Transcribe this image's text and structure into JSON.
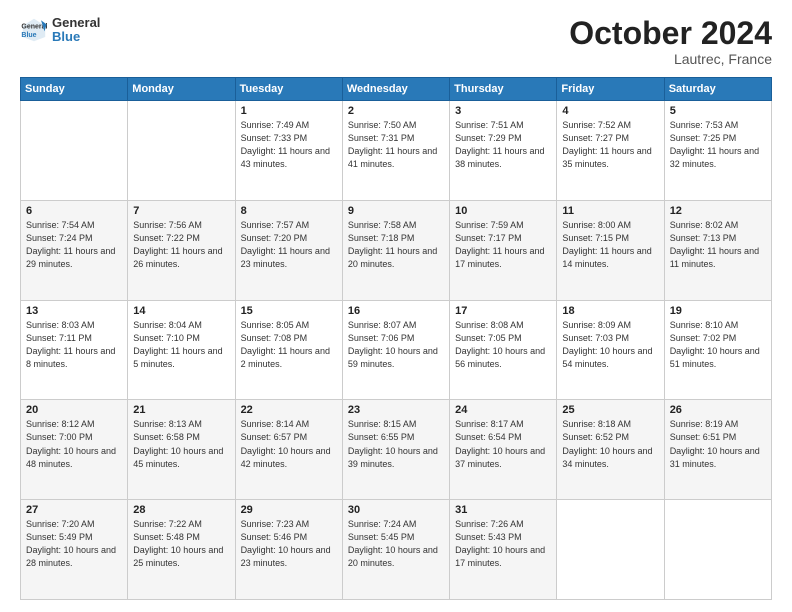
{
  "header": {
    "logo_general": "General",
    "logo_blue": "Blue",
    "month_title": "October 2024",
    "location": "Lautrec, France"
  },
  "days_of_week": [
    "Sunday",
    "Monday",
    "Tuesday",
    "Wednesday",
    "Thursday",
    "Friday",
    "Saturday"
  ],
  "weeks": [
    [
      {
        "day": "",
        "info": ""
      },
      {
        "day": "",
        "info": ""
      },
      {
        "day": "1",
        "info": "Sunrise: 7:49 AM\nSunset: 7:33 PM\nDaylight: 11 hours and 43 minutes."
      },
      {
        "day": "2",
        "info": "Sunrise: 7:50 AM\nSunset: 7:31 PM\nDaylight: 11 hours and 41 minutes."
      },
      {
        "day": "3",
        "info": "Sunrise: 7:51 AM\nSunset: 7:29 PM\nDaylight: 11 hours and 38 minutes."
      },
      {
        "day": "4",
        "info": "Sunrise: 7:52 AM\nSunset: 7:27 PM\nDaylight: 11 hours and 35 minutes."
      },
      {
        "day": "5",
        "info": "Sunrise: 7:53 AM\nSunset: 7:25 PM\nDaylight: 11 hours and 32 minutes."
      }
    ],
    [
      {
        "day": "6",
        "info": "Sunrise: 7:54 AM\nSunset: 7:24 PM\nDaylight: 11 hours and 29 minutes."
      },
      {
        "day": "7",
        "info": "Sunrise: 7:56 AM\nSunset: 7:22 PM\nDaylight: 11 hours and 26 minutes."
      },
      {
        "day": "8",
        "info": "Sunrise: 7:57 AM\nSunset: 7:20 PM\nDaylight: 11 hours and 23 minutes."
      },
      {
        "day": "9",
        "info": "Sunrise: 7:58 AM\nSunset: 7:18 PM\nDaylight: 11 hours and 20 minutes."
      },
      {
        "day": "10",
        "info": "Sunrise: 7:59 AM\nSunset: 7:17 PM\nDaylight: 11 hours and 17 minutes."
      },
      {
        "day": "11",
        "info": "Sunrise: 8:00 AM\nSunset: 7:15 PM\nDaylight: 11 hours and 14 minutes."
      },
      {
        "day": "12",
        "info": "Sunrise: 8:02 AM\nSunset: 7:13 PM\nDaylight: 11 hours and 11 minutes."
      }
    ],
    [
      {
        "day": "13",
        "info": "Sunrise: 8:03 AM\nSunset: 7:11 PM\nDaylight: 11 hours and 8 minutes."
      },
      {
        "day": "14",
        "info": "Sunrise: 8:04 AM\nSunset: 7:10 PM\nDaylight: 11 hours and 5 minutes."
      },
      {
        "day": "15",
        "info": "Sunrise: 8:05 AM\nSunset: 7:08 PM\nDaylight: 11 hours and 2 minutes."
      },
      {
        "day": "16",
        "info": "Sunrise: 8:07 AM\nSunset: 7:06 PM\nDaylight: 10 hours and 59 minutes."
      },
      {
        "day": "17",
        "info": "Sunrise: 8:08 AM\nSunset: 7:05 PM\nDaylight: 10 hours and 56 minutes."
      },
      {
        "day": "18",
        "info": "Sunrise: 8:09 AM\nSunset: 7:03 PM\nDaylight: 10 hours and 54 minutes."
      },
      {
        "day": "19",
        "info": "Sunrise: 8:10 AM\nSunset: 7:02 PM\nDaylight: 10 hours and 51 minutes."
      }
    ],
    [
      {
        "day": "20",
        "info": "Sunrise: 8:12 AM\nSunset: 7:00 PM\nDaylight: 10 hours and 48 minutes."
      },
      {
        "day": "21",
        "info": "Sunrise: 8:13 AM\nSunset: 6:58 PM\nDaylight: 10 hours and 45 minutes."
      },
      {
        "day": "22",
        "info": "Sunrise: 8:14 AM\nSunset: 6:57 PM\nDaylight: 10 hours and 42 minutes."
      },
      {
        "day": "23",
        "info": "Sunrise: 8:15 AM\nSunset: 6:55 PM\nDaylight: 10 hours and 39 minutes."
      },
      {
        "day": "24",
        "info": "Sunrise: 8:17 AM\nSunset: 6:54 PM\nDaylight: 10 hours and 37 minutes."
      },
      {
        "day": "25",
        "info": "Sunrise: 8:18 AM\nSunset: 6:52 PM\nDaylight: 10 hours and 34 minutes."
      },
      {
        "day": "26",
        "info": "Sunrise: 8:19 AM\nSunset: 6:51 PM\nDaylight: 10 hours and 31 minutes."
      }
    ],
    [
      {
        "day": "27",
        "info": "Sunrise: 7:20 AM\nSunset: 5:49 PM\nDaylight: 10 hours and 28 minutes."
      },
      {
        "day": "28",
        "info": "Sunrise: 7:22 AM\nSunset: 5:48 PM\nDaylight: 10 hours and 25 minutes."
      },
      {
        "day": "29",
        "info": "Sunrise: 7:23 AM\nSunset: 5:46 PM\nDaylight: 10 hours and 23 minutes."
      },
      {
        "day": "30",
        "info": "Sunrise: 7:24 AM\nSunset: 5:45 PM\nDaylight: 10 hours and 20 minutes."
      },
      {
        "day": "31",
        "info": "Sunrise: 7:26 AM\nSunset: 5:43 PM\nDaylight: 10 hours and 17 minutes."
      },
      {
        "day": "",
        "info": ""
      },
      {
        "day": "",
        "info": ""
      }
    ]
  ]
}
